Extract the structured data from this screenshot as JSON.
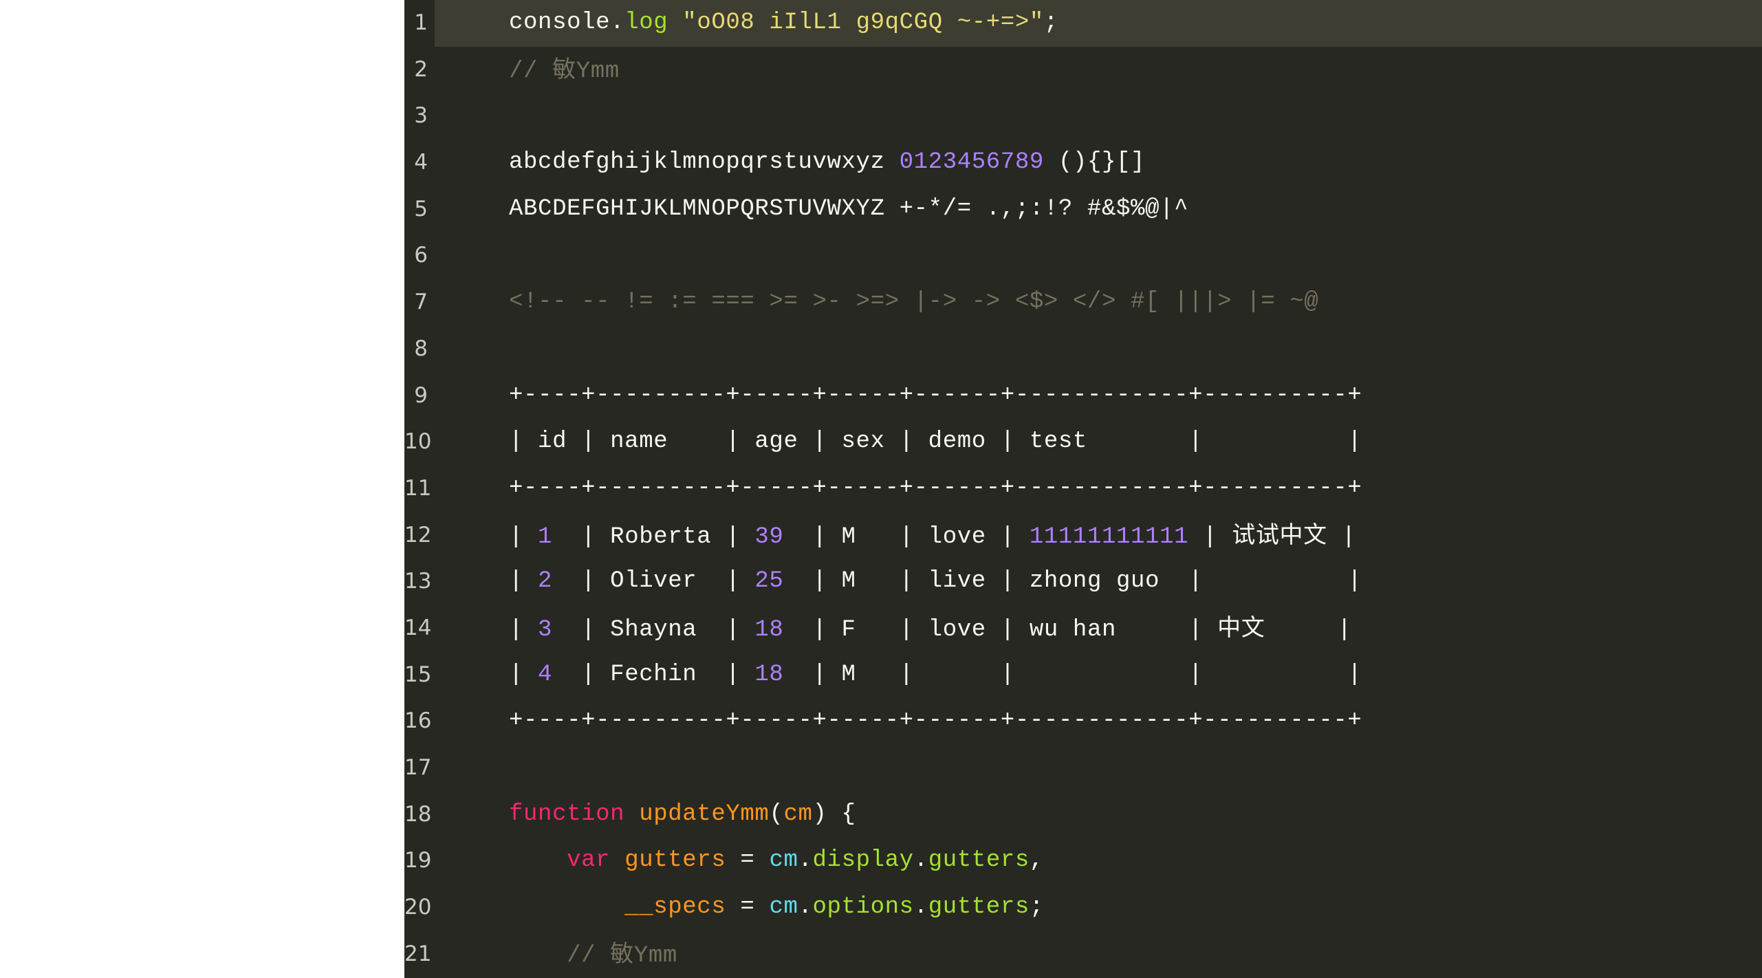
{
  "editor": {
    "name": "code-editor",
    "theme": "monokai",
    "background": "#272822",
    "active_line_background": "#3e3d32",
    "gutter_color": "#c9cac4",
    "page_background": "#ffffff",
    "active_line": 1,
    "total_lines": 21,
    "colors": {
      "plain": "#f8f8f2",
      "function": "#a6e22e",
      "string": "#e6db74",
      "comment": "#75715e",
      "number": "#ae81ff",
      "keyword": "#f92672",
      "identifier": "#fd971f",
      "parameter": "#66d9ef",
      "property": "#a6e22e"
    },
    "line_numbers": [
      "1",
      "2",
      "3",
      "4",
      "5",
      "6",
      "7",
      "8",
      "9",
      "10",
      "11",
      "12",
      "13",
      "14",
      "15",
      "16",
      "17",
      "18",
      "19",
      "20",
      "21"
    ],
    "lines": [
      {
        "number": "1",
        "active": true,
        "tokens": [
          {
            "t": "plain",
            "s": "console."
          },
          {
            "t": "func",
            "s": "log"
          },
          {
            "t": "plain",
            "s": " "
          },
          {
            "t": "string",
            "s": "\"oO08 iIlL1 g9qCGQ ~-+=>\""
          },
          {
            "t": "plain",
            "s": ";"
          }
        ]
      },
      {
        "number": "2",
        "active": false,
        "tokens": [
          {
            "t": "comment",
            "s": "// "
          },
          {
            "t": "comment",
            "s": "敏",
            "cjk": true
          },
          {
            "t": "comment",
            "s": "Ymm"
          }
        ]
      },
      {
        "number": "3",
        "active": false,
        "tokens": []
      },
      {
        "number": "4",
        "active": false,
        "tokens": [
          {
            "t": "plain",
            "s": "abcdefghijklmnopqrstuvwxyz "
          },
          {
            "t": "number",
            "s": "0123456789"
          },
          {
            "t": "plain",
            "s": " (){}[]"
          }
        ]
      },
      {
        "number": "5",
        "active": false,
        "tokens": [
          {
            "t": "plain",
            "s": "ABCDEFGHIJKLMNOPQRSTUVWXYZ +-*/= .,;:!? #&$%@|^"
          }
        ]
      },
      {
        "number": "6",
        "active": false,
        "tokens": []
      },
      {
        "number": "7",
        "active": false,
        "tokens": [
          {
            "t": "comment",
            "s": "<!-- -- != := === >= >- >=> |-> -> <$> </> #[ |||> |= ~@"
          }
        ]
      },
      {
        "number": "8",
        "active": false,
        "tokens": []
      },
      {
        "number": "9",
        "active": false,
        "tokens": [
          {
            "t": "plain",
            "s": "+----+---------+-----+-----+------+------------+----------+"
          }
        ]
      },
      {
        "number": "10",
        "active": false,
        "tokens": [
          {
            "t": "plain",
            "s": "| id | name    | age | sex | demo | test       |          |"
          }
        ]
      },
      {
        "number": "11",
        "active": false,
        "tokens": [
          {
            "t": "plain",
            "s": "+----+---------+-----+-----+------+------------+----------+"
          }
        ]
      },
      {
        "number": "12",
        "active": false,
        "tokens": [
          {
            "t": "plain",
            "s": "| "
          },
          {
            "t": "number",
            "s": "1"
          },
          {
            "t": "plain",
            "s": "  | Roberta | "
          },
          {
            "t": "number",
            "s": "39"
          },
          {
            "t": "plain",
            "s": "  | M   | love | "
          },
          {
            "t": "number",
            "s": "11111111111"
          },
          {
            "t": "plain",
            "s": " | "
          },
          {
            "t": "plain",
            "s": "试试中文",
            "cjk": true
          },
          {
            "t": "plain",
            "s": " |"
          }
        ]
      },
      {
        "number": "13",
        "active": false,
        "tokens": [
          {
            "t": "plain",
            "s": "| "
          },
          {
            "t": "number",
            "s": "2"
          },
          {
            "t": "plain",
            "s": "  | Oliver  | "
          },
          {
            "t": "number",
            "s": "25"
          },
          {
            "t": "plain",
            "s": "  | M   | live | zhong guo  |          |"
          }
        ]
      },
      {
        "number": "14",
        "active": false,
        "tokens": [
          {
            "t": "plain",
            "s": "| "
          },
          {
            "t": "number",
            "s": "3"
          },
          {
            "t": "plain",
            "s": "  | Shayna  | "
          },
          {
            "t": "number",
            "s": "18"
          },
          {
            "t": "plain",
            "s": "  | F   | love | wu han     | "
          },
          {
            "t": "plain",
            "s": "中文",
            "cjk": true
          },
          {
            "t": "plain",
            "s": "     |"
          }
        ]
      },
      {
        "number": "15",
        "active": false,
        "tokens": [
          {
            "t": "plain",
            "s": "| "
          },
          {
            "t": "number",
            "s": "4"
          },
          {
            "t": "plain",
            "s": "  | Fechin  | "
          },
          {
            "t": "number",
            "s": "18"
          },
          {
            "t": "plain",
            "s": "  | M   |      |            |          |"
          }
        ]
      },
      {
        "number": "16",
        "active": false,
        "tokens": [
          {
            "t": "plain",
            "s": "+----+---------+-----+-----+------+------------+----------+"
          }
        ]
      },
      {
        "number": "17",
        "active": false,
        "tokens": []
      },
      {
        "number": "18",
        "active": false,
        "tokens": [
          {
            "t": "keyword",
            "s": "function"
          },
          {
            "t": "plain",
            "s": " "
          },
          {
            "t": "ident",
            "s": "updateYmm"
          },
          {
            "t": "punct",
            "s": "("
          },
          {
            "t": "ident",
            "s": "cm"
          },
          {
            "t": "punct",
            "s": ") {"
          }
        ]
      },
      {
        "number": "19",
        "active": false,
        "tokens": [
          {
            "t": "plain",
            "s": "    "
          },
          {
            "t": "keyword",
            "s": "var"
          },
          {
            "t": "plain",
            "s": " "
          },
          {
            "t": "ident",
            "s": "gutters"
          },
          {
            "t": "op",
            "s": " = "
          },
          {
            "t": "param",
            "s": "cm"
          },
          {
            "t": "punct",
            "s": "."
          },
          {
            "t": "prop",
            "s": "display"
          },
          {
            "t": "punct",
            "s": "."
          },
          {
            "t": "prop",
            "s": "gutters"
          },
          {
            "t": "punct",
            "s": ","
          }
        ]
      },
      {
        "number": "20",
        "active": false,
        "tokens": [
          {
            "t": "plain",
            "s": "        "
          },
          {
            "t": "ident",
            "s": "__specs"
          },
          {
            "t": "op",
            "s": " = "
          },
          {
            "t": "param",
            "s": "cm"
          },
          {
            "t": "punct",
            "s": "."
          },
          {
            "t": "prop",
            "s": "options"
          },
          {
            "t": "punct",
            "s": "."
          },
          {
            "t": "prop",
            "s": "gutters"
          },
          {
            "t": "punct",
            "s": ";"
          }
        ]
      },
      {
        "number": "21",
        "active": false,
        "tokens": [
          {
            "t": "plain",
            "s": "    "
          },
          {
            "t": "comment",
            "s": "// "
          },
          {
            "t": "comment",
            "s": "敏",
            "cjk": true
          },
          {
            "t": "comment",
            "s": "Ymm"
          }
        ]
      }
    ]
  }
}
